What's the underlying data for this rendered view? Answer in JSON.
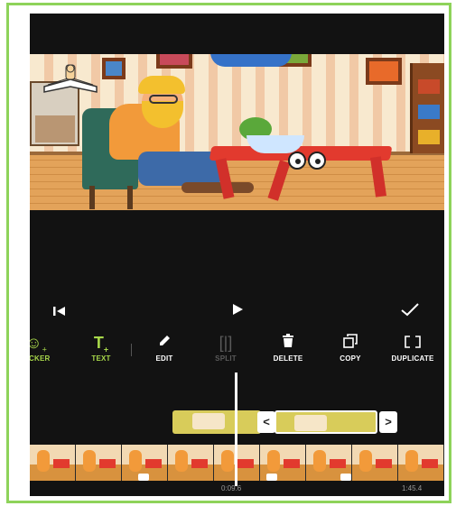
{
  "controls": {
    "prev_icon": "skip-to-start-icon",
    "play_icon": "play-icon",
    "done_icon": "checkmark-icon"
  },
  "toolbar": {
    "items": [
      {
        "label": "TICKER",
        "icon": "sticker-icon",
        "state": "active"
      },
      {
        "label": "TEXT",
        "icon": "text-add-icon",
        "state": "active"
      },
      {
        "label": "EDIT",
        "icon": "pencil-icon",
        "state": "normal"
      },
      {
        "label": "SPLIT",
        "icon": "split-icon",
        "state": "disabled"
      },
      {
        "label": "DELETE",
        "icon": "trash-icon",
        "state": "normal"
      },
      {
        "label": "COPY",
        "icon": "copy-icon",
        "state": "normal"
      },
      {
        "label": "DUPLICATE",
        "icon": "duplicate-icon",
        "state": "normal"
      }
    ]
  },
  "timeline": {
    "current_time": "0:09.6",
    "total_time": "1:45.4",
    "handle_left": "<",
    "handle_right": ">"
  },
  "colors": {
    "accent_green": "#a8d84a",
    "clip_yellow": "#d8cc5a",
    "frame_green": "#8ed35a",
    "background": "#121212"
  }
}
